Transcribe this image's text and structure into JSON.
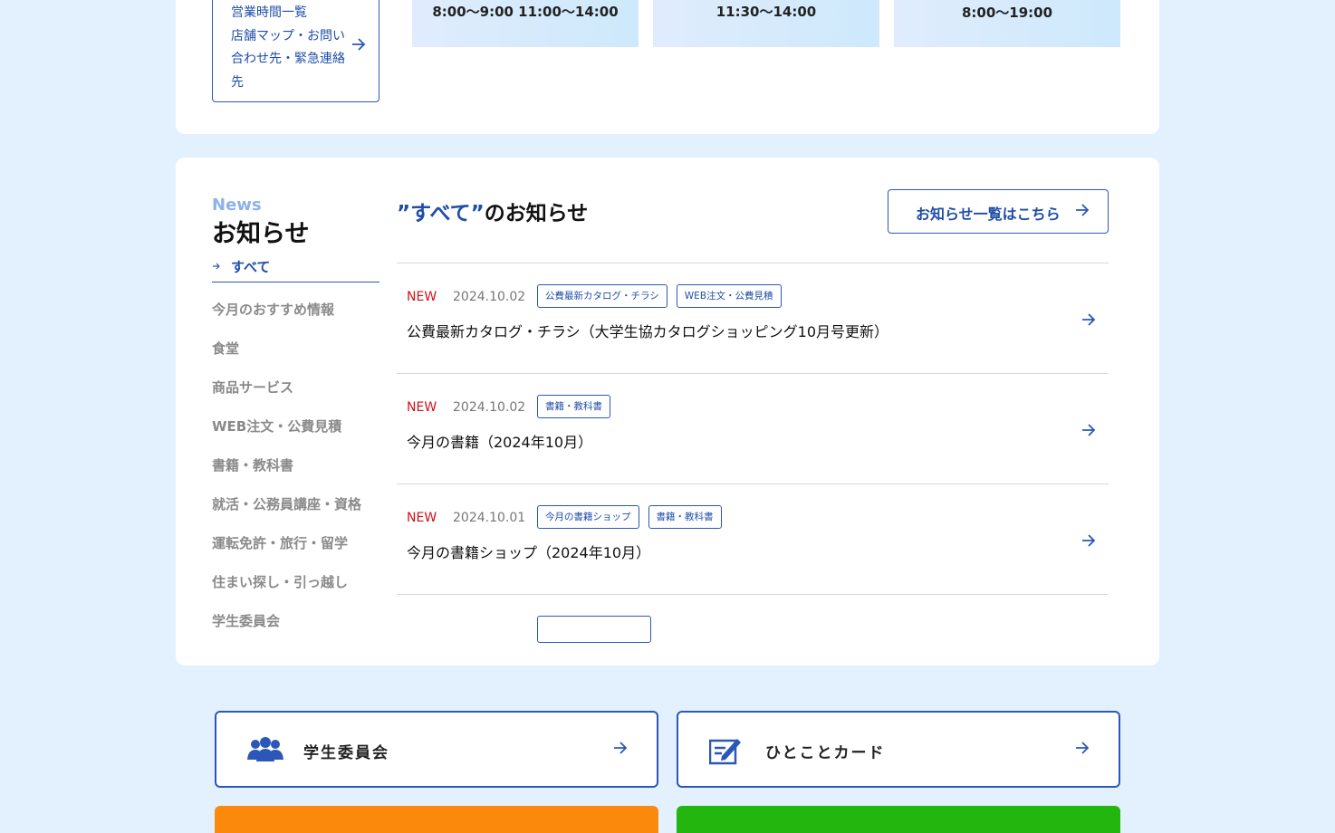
{
  "hours": {
    "link_lines": [
      "営業時間一覧",
      "店舗マップ・お問い",
      "合わせ先・緊急連絡",
      "先"
    ],
    "boxes": [
      "8:00〜9:00 11:00〜14:00",
      "11:30〜14:00",
      "8:00〜19:00"
    ]
  },
  "news": {
    "label_en": "News",
    "label_ja": "お知らせ",
    "active_category": "すべて",
    "categories": [
      "今月のおすすめ情報",
      "食堂",
      "商品サービス",
      "WEB注文・公費見積",
      "書籍・教科書",
      "就活・公務員講座・資格",
      "運転免許・旅行・留学",
      "住まい探し・引っ越し",
      "学生委員会"
    ],
    "heading_quoted": "”すべて”",
    "heading_rest": "のお知らせ",
    "all_button": "お知らせ一覧はこちら",
    "items": [
      {
        "new": "NEW",
        "date": "2024.10.02",
        "tags": [
          "公費最新カタログ・チラシ",
          "WEB注文・公費見積"
        ],
        "title": "公費最新カタログ・チラシ（大学生協カタログショッピング10月号更新）"
      },
      {
        "new": "NEW",
        "date": "2024.10.02",
        "tags": [
          "書籍・教科書"
        ],
        "title": "今月の書籍（2024年10月）"
      },
      {
        "new": "NEW",
        "date": "2024.10.01",
        "tags": [
          "今月の書籍ショップ",
          "書籍・教科書"
        ],
        "title": "今月の書籍ショップ（2024年10月）"
      }
    ]
  },
  "bottom": {
    "student_committee": "学生委員会",
    "hitokoto_card": "ひとことカード"
  },
  "colors": {
    "accent": "#1f4ea8",
    "new_red": "#d0101a",
    "orange": "#fb8a0c",
    "green": "#22b60f",
    "page_bg": "#e3f1fe"
  }
}
